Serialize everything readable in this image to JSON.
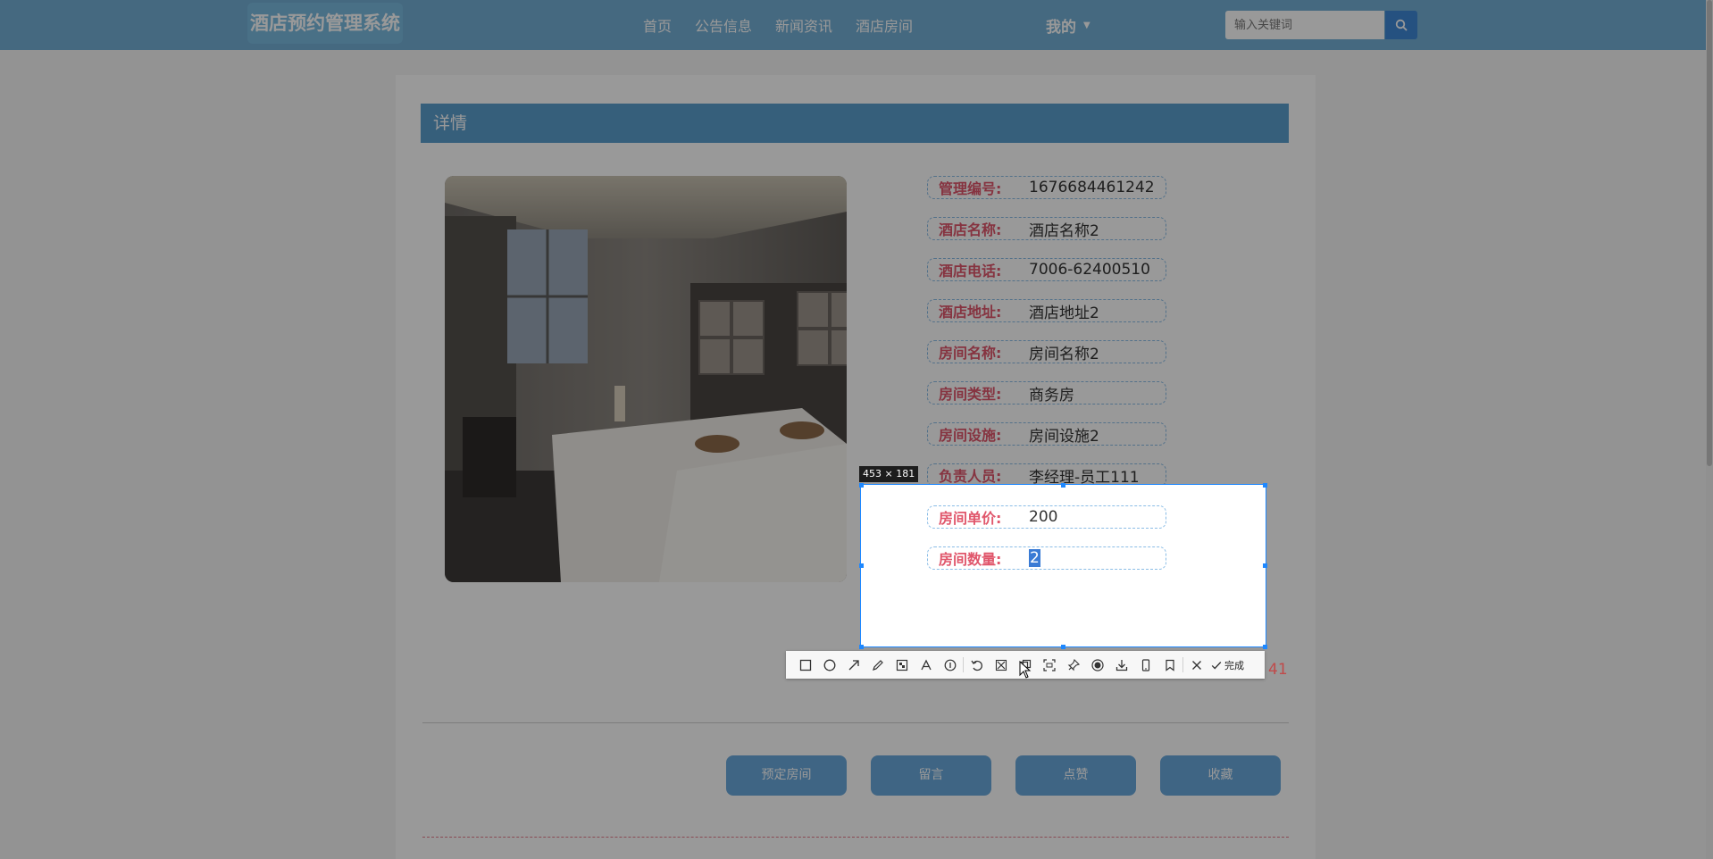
{
  "header": {
    "brand": "酒店预约管理系统",
    "nav": [
      "首页",
      "公告信息",
      "新闻资讯",
      "酒店房间"
    ],
    "mine_label": "我的",
    "search_placeholder": "输入关键词"
  },
  "detail": {
    "section_title": "详情",
    "rows": [
      {
        "label": "管理编号:",
        "value": "1676684461242"
      },
      {
        "label": "酒店名称:",
        "value": "酒店名称2"
      },
      {
        "label": "酒店电话:",
        "value": "7006-62400510"
      },
      {
        "label": "酒店地址:",
        "value": "酒店地址2"
      },
      {
        "label": "房间名称:",
        "value": "房间名称2"
      },
      {
        "label": "房间类型:",
        "value": "商务房"
      },
      {
        "label": "房间设施:",
        "value": "房间设施2"
      },
      {
        "label": "负责人员:",
        "value": "李经理-员工111"
      },
      {
        "label": "房间单价:",
        "value": "200"
      },
      {
        "label": "房间数量:",
        "value": "2"
      }
    ],
    "actions": [
      "预定房间",
      "留言",
      "点赞",
      "收藏"
    ]
  },
  "screenshot_tool": {
    "size_label": "453 × 181",
    "done_label": "完成",
    "overflow_text": "41",
    "tools": [
      "rectangle-icon",
      "ellipse-icon",
      "arrow-icon",
      "pen-icon",
      "mosaic-icon",
      "text-icon",
      "number-icon",
      "undo-icon",
      "scissors-icon",
      "image-copy-icon",
      "ocr-icon",
      "pin-icon",
      "record-icon",
      "download-icon",
      "phone-icon",
      "bookmark-icon",
      "close-icon",
      "check-icon"
    ]
  },
  "colors": {
    "nav_bg": "#74afd6",
    "section_bg": "#5b9ece",
    "label": "#e0566b",
    "button": "#6aa8dc",
    "selection_border": "#1e88ff"
  }
}
